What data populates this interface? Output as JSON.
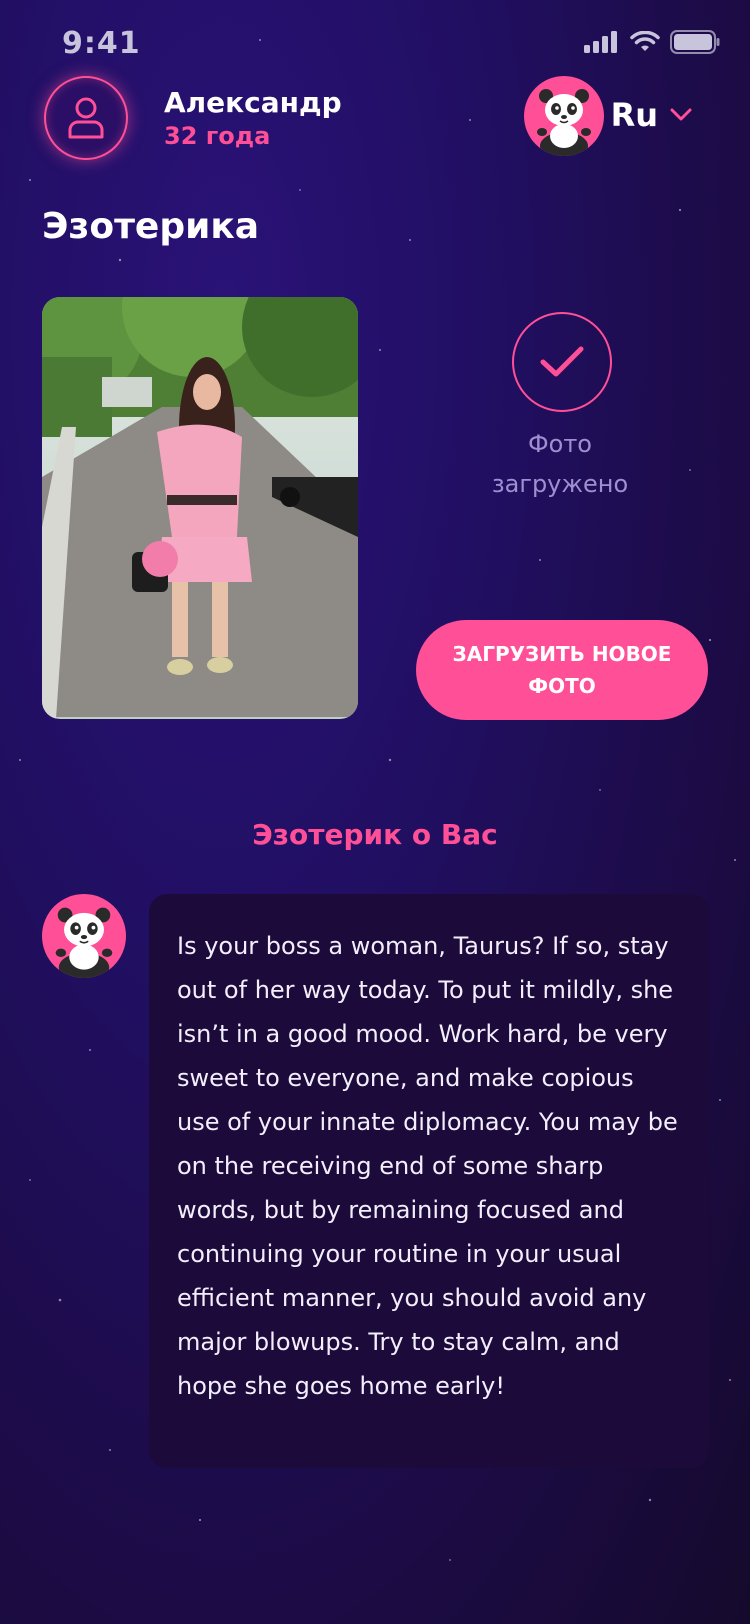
{
  "status_bar": {
    "time": "9:41"
  },
  "user": {
    "name": "Александр",
    "age": "32 года"
  },
  "language": {
    "selected": "Ru"
  },
  "page_title": "Эзотерика",
  "photo": {
    "status_text": "Фото загружено",
    "upload_button": "ЗАГРУЗИТЬ НОВОЕ ФОТО"
  },
  "section_title": "Эзотерик о Вас",
  "message": {
    "text": "Is your boss a woman, Taurus? If so, stay out of her way today. To put it mildly, she isn’t in a good mood. Work hard, be very sweet to everyone, and make copious use of your innate diplomacy. You may be on the receiving end of some sharp words, but by remaining focused and continuing your routine in your usual efficient manner, you should avoid any major blowups. Try to stay calm, and hope she goes home early!"
  },
  "colors": {
    "accent": "#ff4f97",
    "background": "#210f63",
    "bubble": "#1c0a3a"
  },
  "icons": [
    "user-icon",
    "panda-icon",
    "chevron-down-icon",
    "check-icon",
    "signal-icon",
    "wifi-icon",
    "battery-icon"
  ]
}
